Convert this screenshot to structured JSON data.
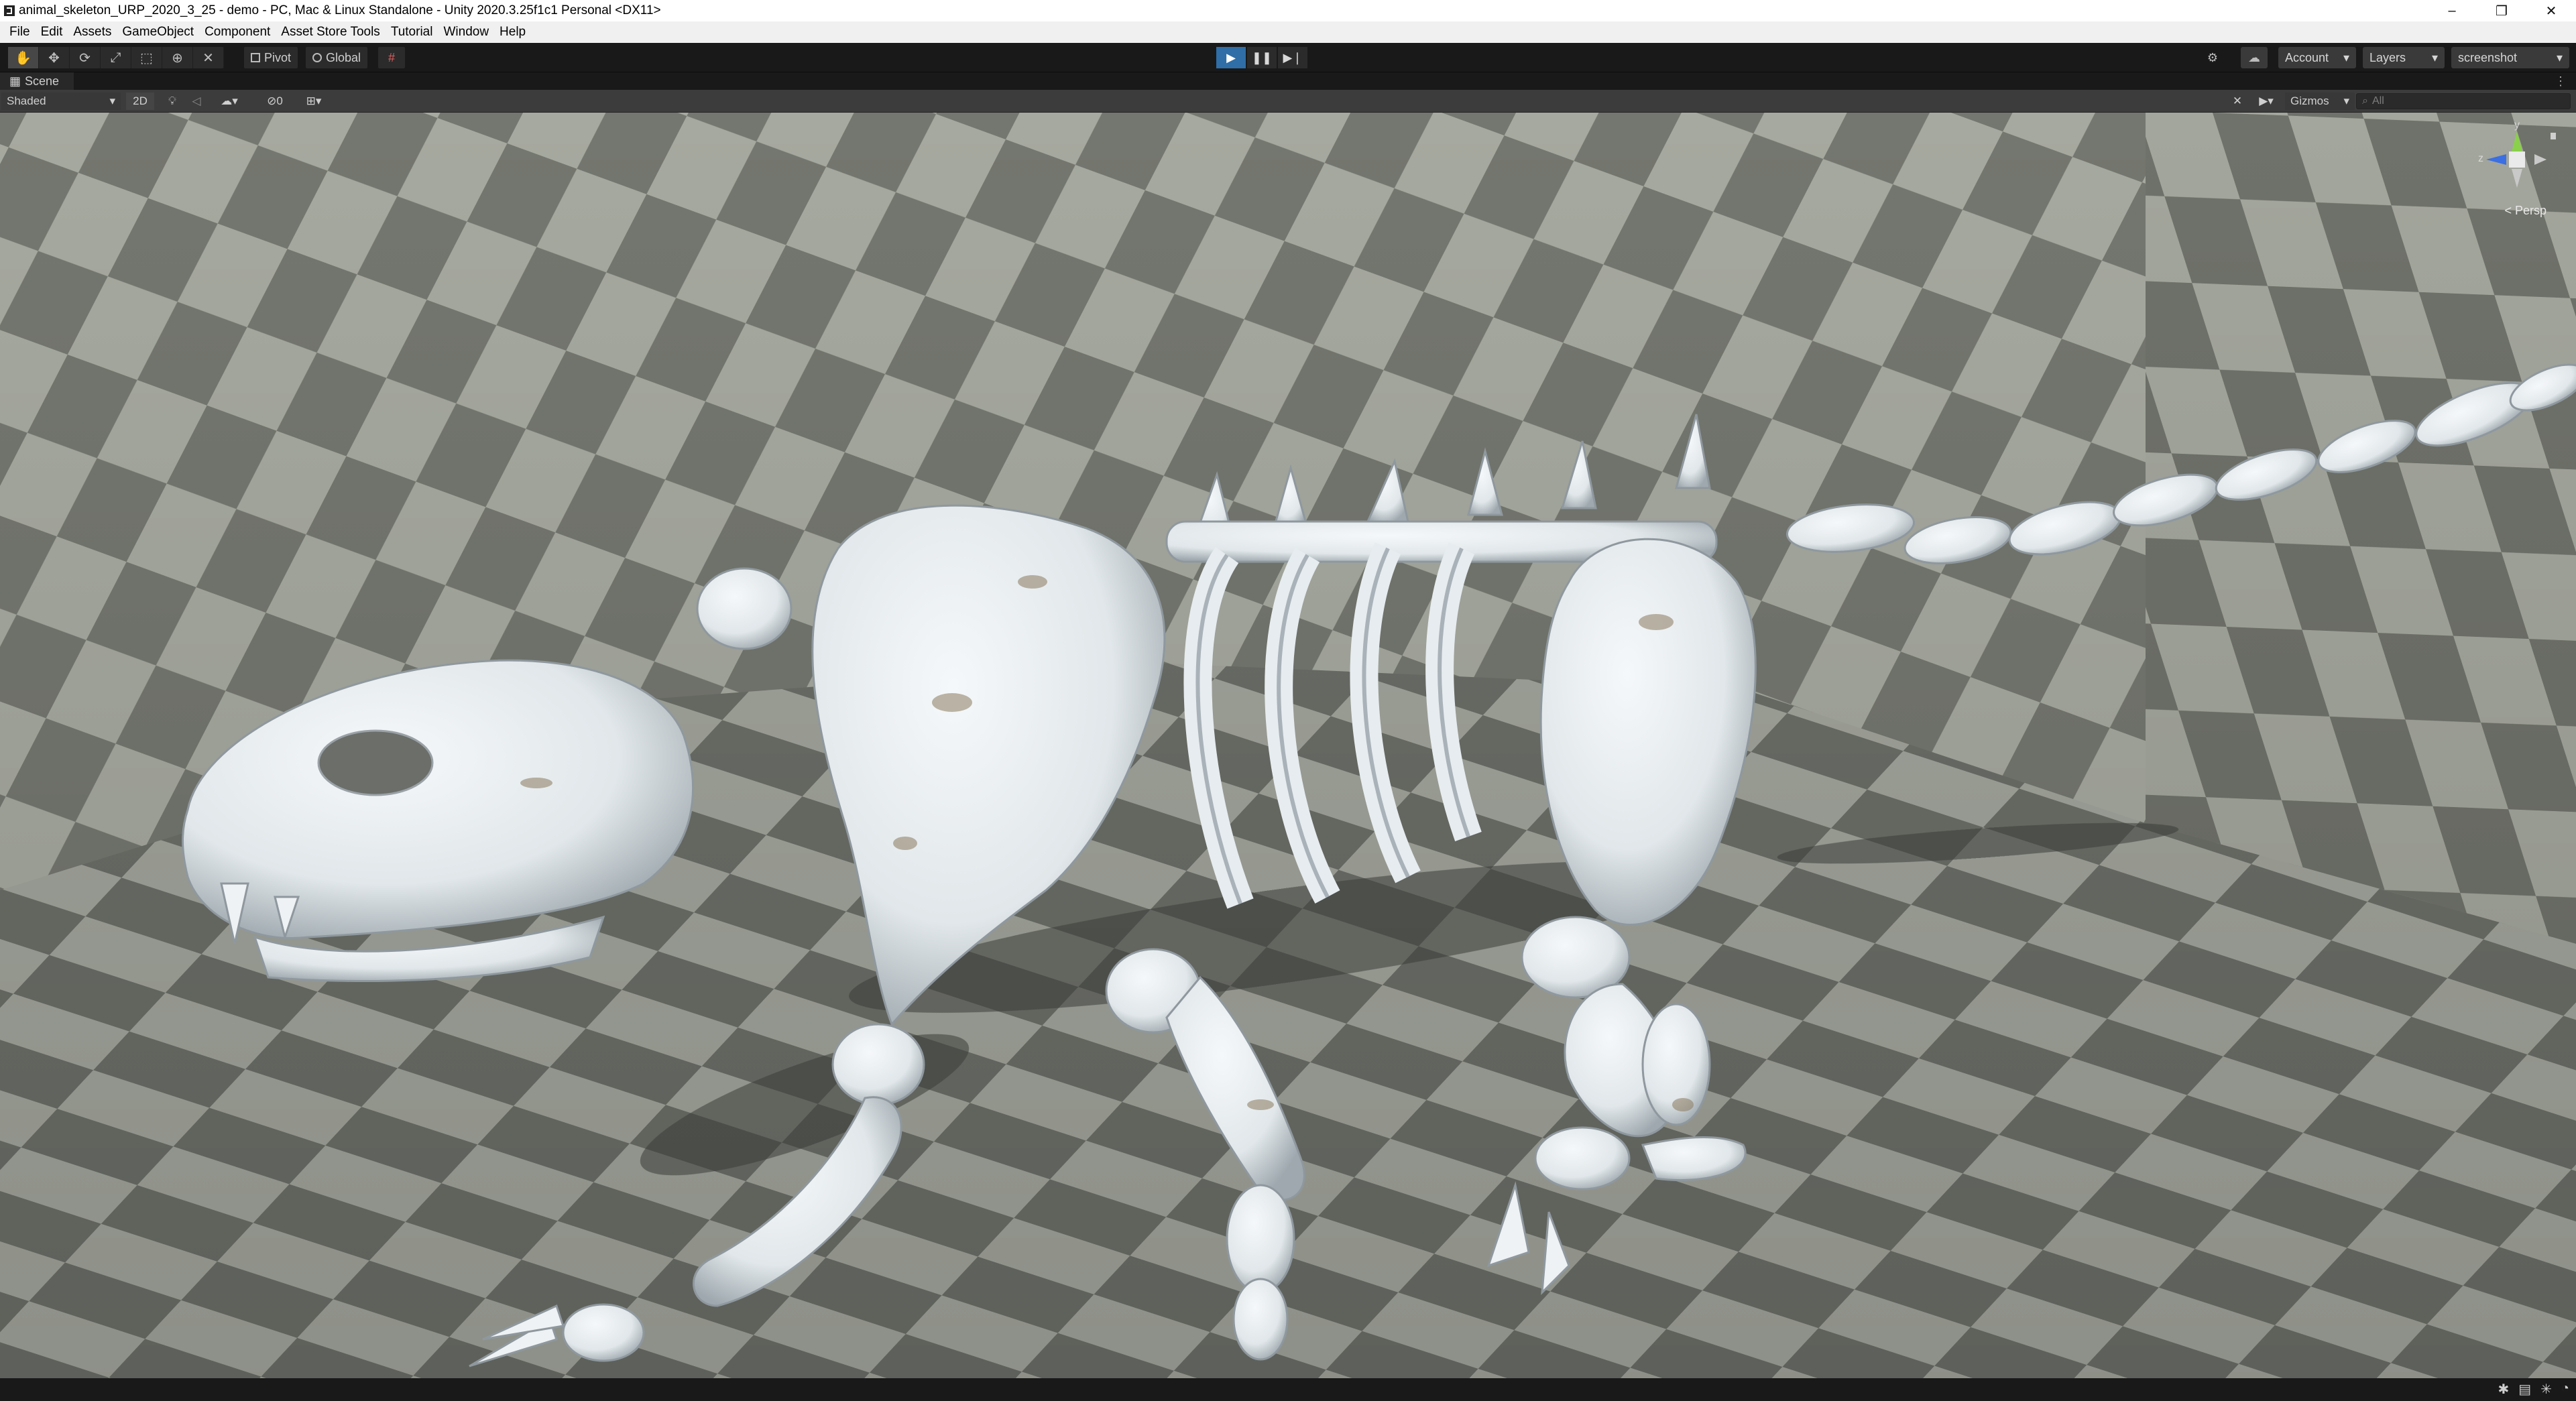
{
  "window": {
    "title": "animal_skeleton_URP_2020_3_25 - demo - PC, Mac & Linux Standalone - Unity 2020.3.25f1c1 Personal <DX11>",
    "controls": {
      "minimize": "–",
      "maximize": "❐",
      "close": "✕"
    }
  },
  "menu": {
    "items": [
      "File",
      "Edit",
      "Assets",
      "GameObject",
      "Component",
      "Asset Store Tools",
      "Tutorial",
      "Window",
      "Help"
    ]
  },
  "toolbar": {
    "tools": [
      {
        "name": "hand-tool",
        "glyph": "✋"
      },
      {
        "name": "move-tool",
        "glyph": "✥"
      },
      {
        "name": "rotate-tool",
        "glyph": "⟳"
      },
      {
        "name": "scale-tool",
        "glyph": "⤢"
      },
      {
        "name": "rect-tool",
        "glyph": "⬚"
      },
      {
        "name": "transform-tool",
        "glyph": "⊕"
      },
      {
        "name": "custom-tool",
        "glyph": "✕"
      }
    ],
    "pivot_label": "Pivot",
    "global_label": "Global",
    "snap_glyph": "#",
    "play_glyph": "▶",
    "pause_glyph": "❚❚",
    "step_glyph": "▶❘",
    "account_label": "Account",
    "layers_label": "Layers",
    "layout_label": "screenshot",
    "dropdown_glyph": "▾",
    "settings_glyph": "⚙",
    "cloud_glyph": "☁"
  },
  "scene_tab": {
    "label": "Scene",
    "tab_glyph": "▦",
    "menu_glyph": "⋮"
  },
  "scene_toolbar": {
    "draw_mode": "Shaded",
    "mode_2d": "2D",
    "hidden_count": "0",
    "gizmos_label": "Gizmos",
    "search_placeholder": "All",
    "search_glyph": "⌕"
  },
  "viewport": {
    "gizmo_axes": {
      "y": "y",
      "z": "z"
    },
    "projection_label": "< Persp",
    "colors": {
      "checker_light": "#a1a49b",
      "checker_dark": "#6b6e67",
      "bone": "#e9eef2",
      "bone_shadow": "#a9b2b8",
      "stain": "#8a7a5e"
    }
  },
  "statusbar": {
    "icons": [
      "bug-icon",
      "package-icon",
      "lighting-icon",
      "status-icon"
    ]
  }
}
